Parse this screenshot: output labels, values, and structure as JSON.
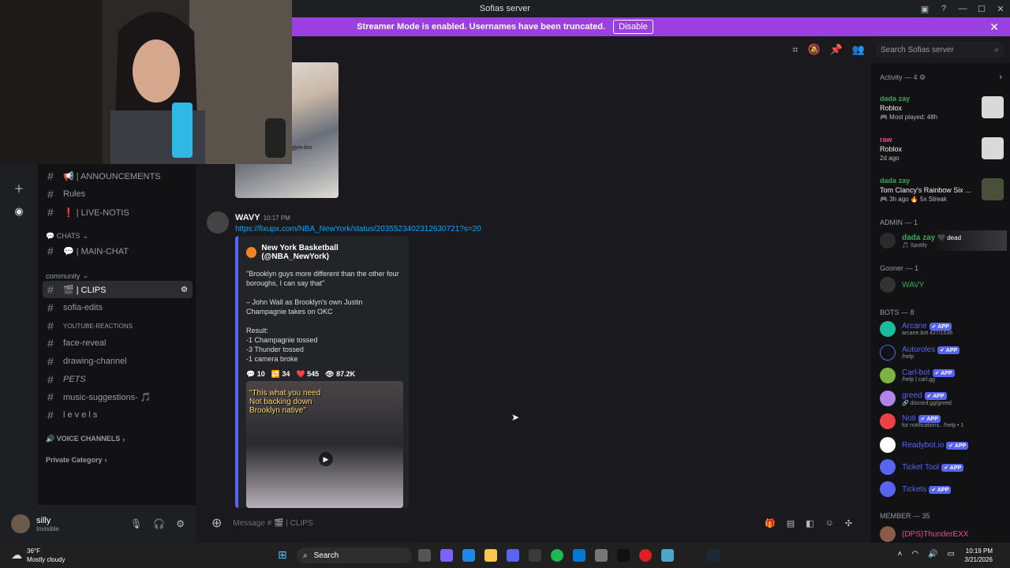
{
  "window": {
    "title": "Sofias server"
  },
  "banner": {
    "text": "Streamer Mode is enabled. Usernames have been truncated.",
    "button": "Disable"
  },
  "search": {
    "placeholder": "Search Sofias server"
  },
  "channels": [
    {
      "label": "📢 | ANNOUNCEMENTS",
      "selected": false
    },
    {
      "label": "Rules",
      "selected": false
    },
    {
      "label": "❗ | LIVE-NOTIS",
      "selected": false
    },
    {
      "label": "💬 | MAIN-CHAT",
      "selected": false
    },
    {
      "label": "🎬 | CLIPS",
      "selected": true
    },
    {
      "label": "sofia-edits",
      "selected": false
    },
    {
      "label": "YOUTUBE-REACTIONS",
      "selected": false
    },
    {
      "label": "face-reveal",
      "selected": false
    },
    {
      "label": "drawing-channel",
      "selected": false
    },
    {
      "label": "PETS",
      "selected": false
    },
    {
      "label": "music-suggestions- 🎵",
      "selected": false
    },
    {
      "label": "l e v e l s",
      "selected": false
    }
  ],
  "categories": {
    "chats": "💬 CHATS",
    "community": "community",
    "voice": "🔊 VOICE CHANNELS",
    "private": "Private Category"
  },
  "user": {
    "name": "silly",
    "status": "Invisible"
  },
  "message": {
    "author": "WAVY",
    "time": "10:17 PM",
    "link": "https://fixupx.com/NBA_NewYork/status/2035523402312630721?s=20",
    "embed_author": "New York Basketball (@NBA_NewYork)",
    "embed_body": "\"Brooklyn guys more different than the other four boroughs, I can say that\"\n\n– John Wall as Brooklyn's own Justin Champagnie takes on OKC\n\nResult:\n-1 Champagnie tossed\n-3 Thunder tossed\n-1 camera broke",
    "stats": {
      "replies": "💬 10",
      "retweets": "🔁 34",
      "likes": "❤️ 545",
      "views": "👁 87.2K"
    },
    "video_caption": "\"This what you need\nNot backing down\nBrooklyn native\"",
    "img_caption": "gym-bro"
  },
  "composer": {
    "placeholder": "Message # 🎬 | CLIPS"
  },
  "members": {
    "activity_header": "Activity — 4",
    "activities": [
      {
        "name": "dada zay",
        "game": "Roblox",
        "sub": "🎮 Most played: 48h"
      },
      {
        "name": "raw",
        "game": "Roblox",
        "sub": "2d ago"
      },
      {
        "name": "dada zay",
        "game": "Tom Clancy's Rainbow Six ...",
        "sub": "🎮 3h ago  🔥 5x Streak"
      }
    ],
    "admin_header": "ADMIN — 1",
    "admin": {
      "name": "dada zay",
      "tag": "🖤 dead",
      "sub": "🎵 Spotify"
    },
    "gooner_header": "Gooner — 1",
    "gooner": {
      "name": "WAVY"
    },
    "bots_header": "BOTS — 8",
    "bots": [
      {
        "name": "Arcane",
        "sub": "arcane.bot 437/1536",
        "color": "#1abc9c"
      },
      {
        "name": "Autoroles",
        "sub": "/help",
        "color": "#5865f2"
      },
      {
        "name": "Carl-bot",
        "sub": "/help | carl.gg",
        "color": "#7cb342"
      },
      {
        "name": "greed",
        "sub": "🔗 discord.gg/greed",
        "color": "#b084e8"
      },
      {
        "name": "Noti",
        "sub": "for notifications.. /help • 1",
        "color": "#ed4245"
      },
      {
        "name": "Readybot.io",
        "sub": "",
        "color": "#ffffff"
      },
      {
        "name": "Ticket Tool",
        "sub": "",
        "color": "#5865f2"
      },
      {
        "name": "Tickets",
        "sub": "",
        "color": "#5865f2"
      }
    ],
    "app_badge": "✔ APP",
    "member_header": "MEMBER — 35",
    "member": {
      "name": "(DPS)ThunderEXX"
    }
  },
  "taskbar": {
    "temp": "36°F",
    "weather": "Mostly cloudy",
    "search": "Search",
    "time": "10:19 PM",
    "date": "3/21/2026"
  }
}
